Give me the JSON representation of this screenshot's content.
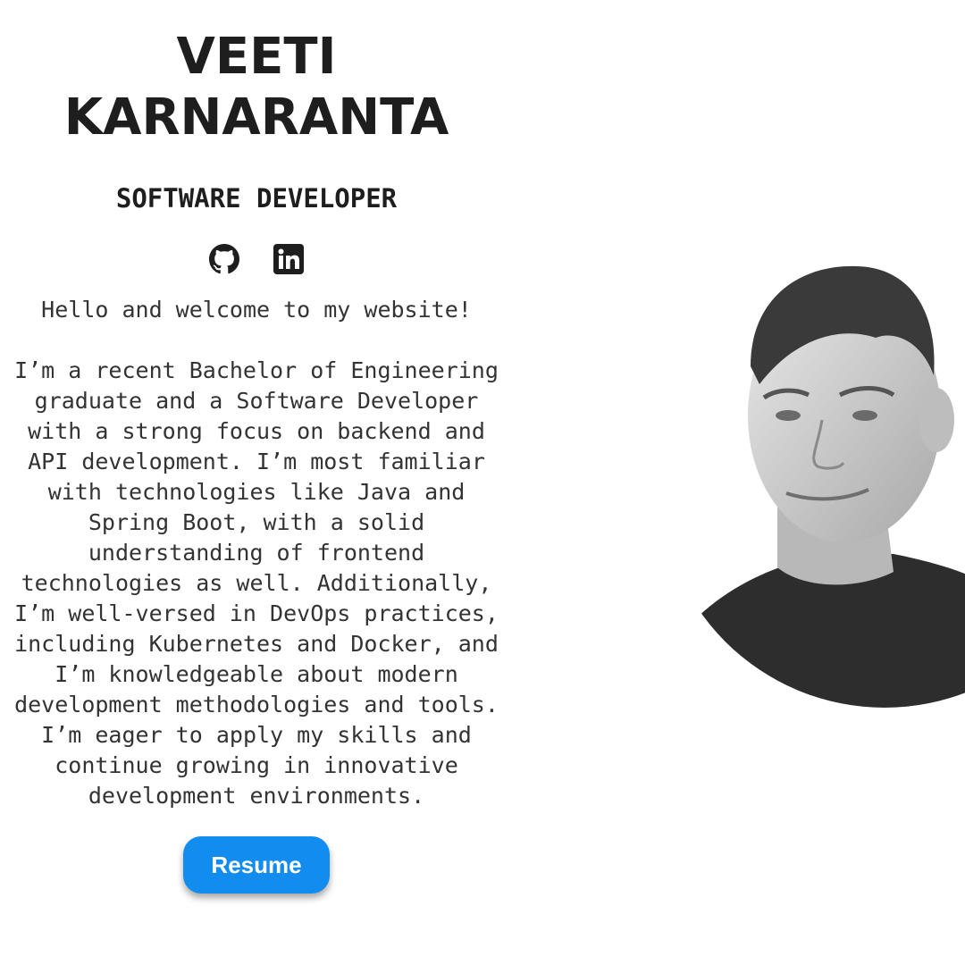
{
  "hero": {
    "name_line1": "VEETI",
    "name_line2": "KARNARANTA",
    "role": "SOFTWARE DEVELOPER"
  },
  "socials": [
    {
      "name": "github-icon"
    },
    {
      "name": "linkedin-icon"
    }
  ],
  "about": {
    "greeting": "Hello and welcome to my website!",
    "body": "I’m a recent Bachelor of Engineering graduate and a Software Developer with a strong focus on backend and API development. I’m most familiar with technologies like Java and Spring Boot, with a solid understanding of frontend technologies as well. Additionally, I’m well-versed in DevOps practices, including Kubernetes and Docker, and I’m knowledgeable about modern development methodologies and tools. I’m eager to apply my skills and continue growing in innovative development environments."
  },
  "actions": {
    "resume_label": "Resume"
  },
  "colors": {
    "accent": "#138cf0",
    "text": "#1e1e1e",
    "background": "#ffffff"
  }
}
